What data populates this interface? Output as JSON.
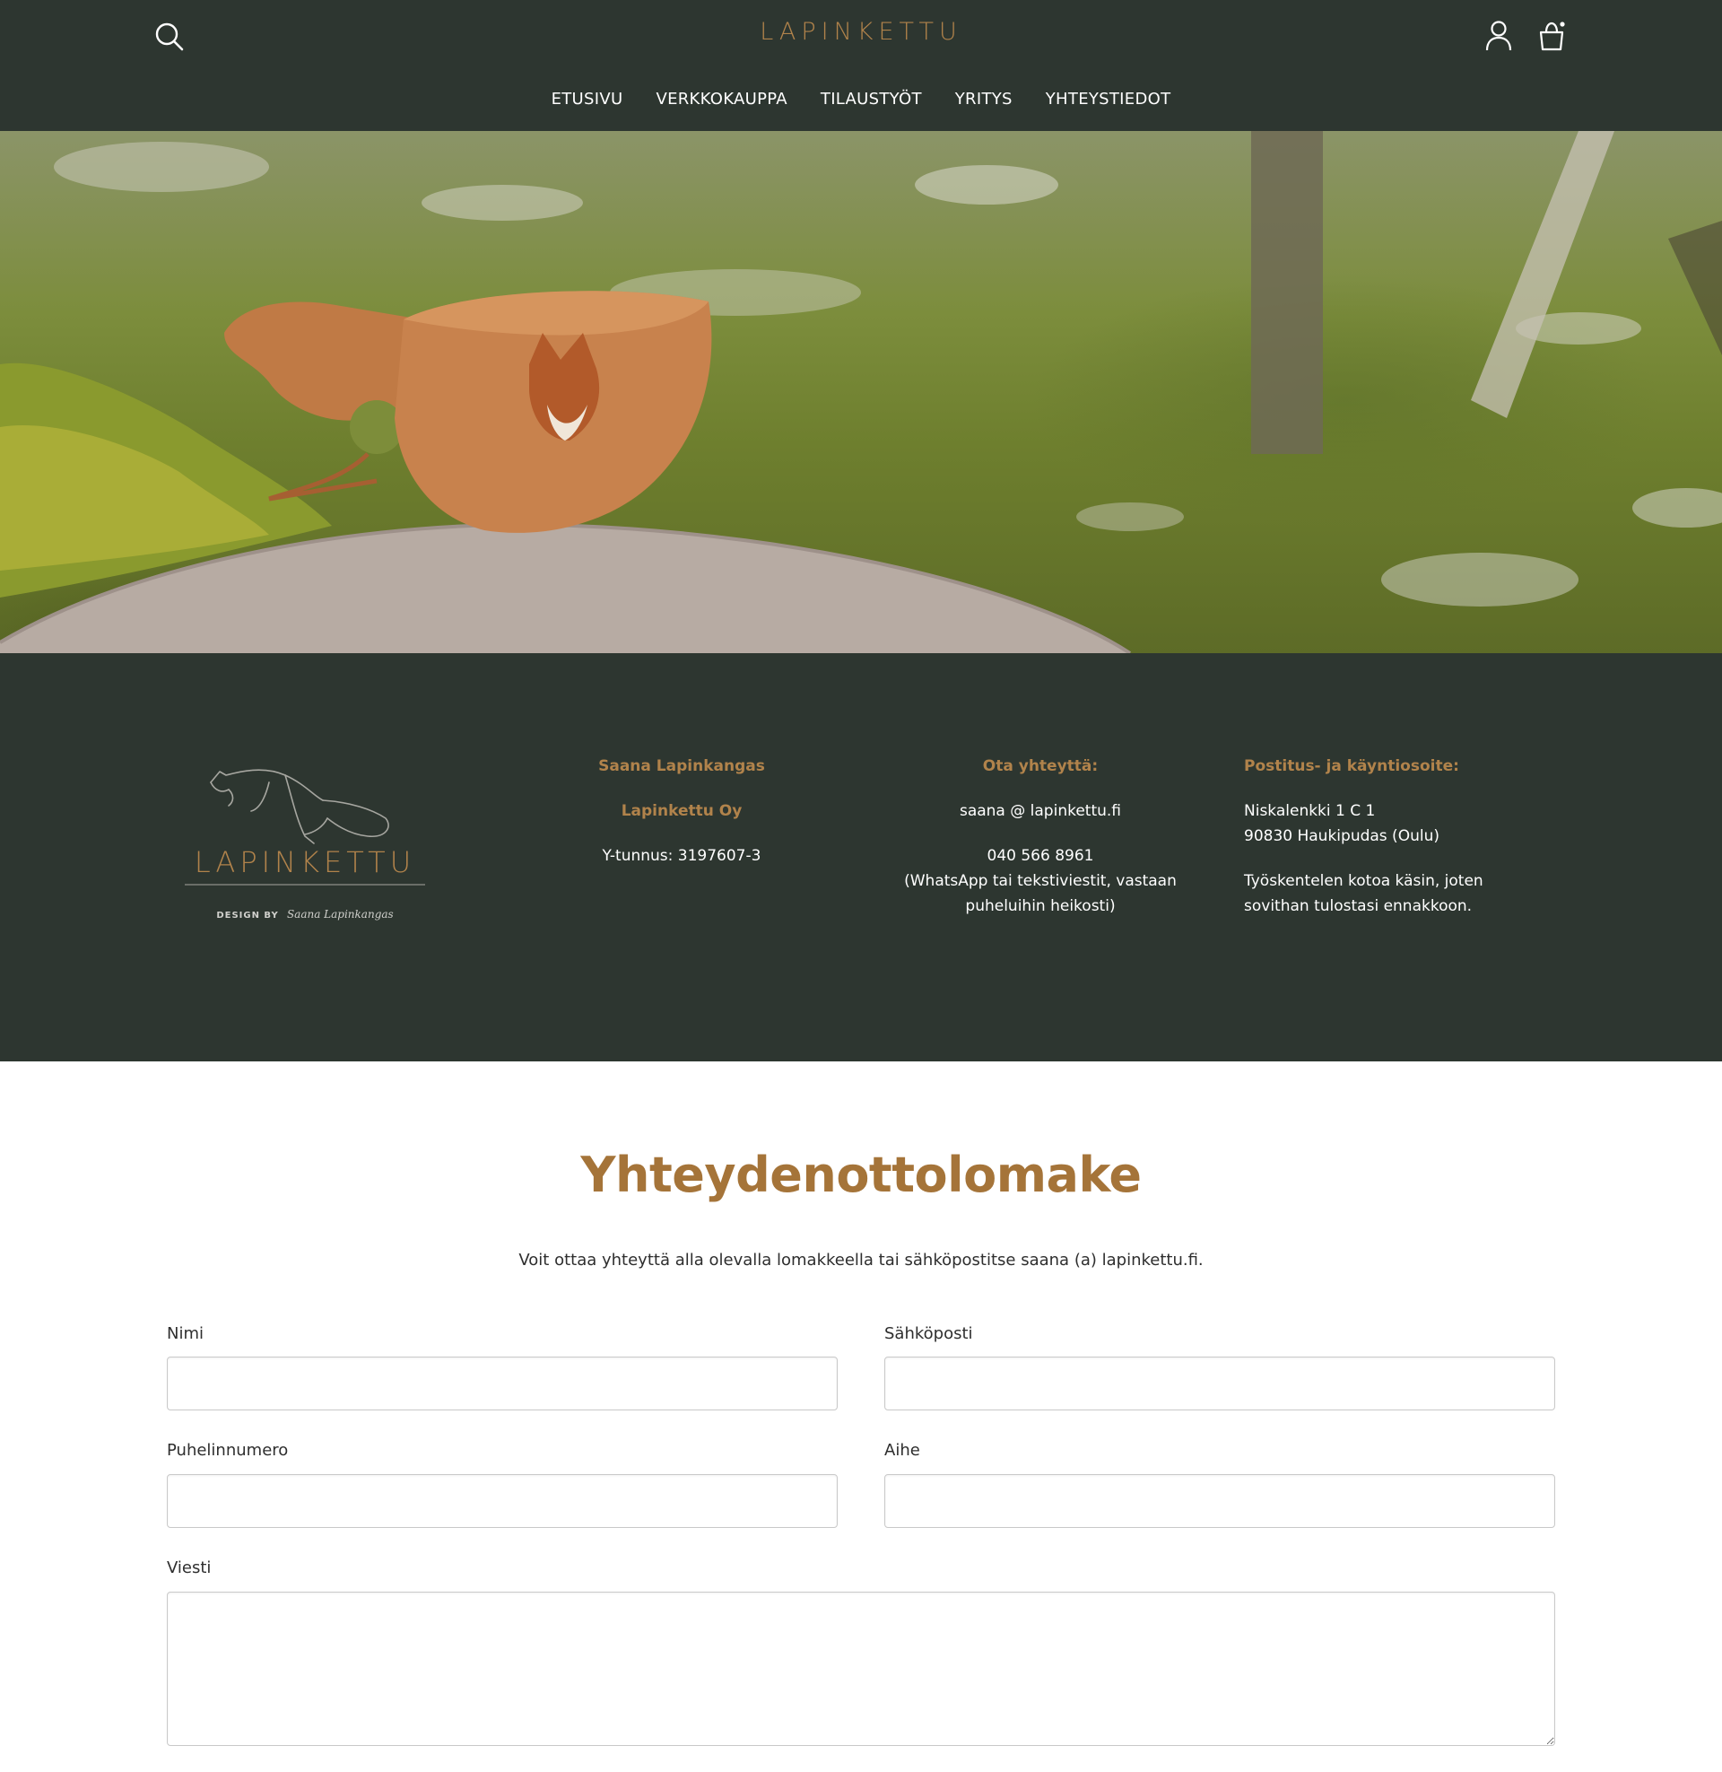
{
  "header": {
    "logo": "LAPINKETTU",
    "icons": {
      "search": "search-icon",
      "account": "user-icon",
      "cart": "shopping-bag-icon"
    },
    "nav": [
      {
        "label": "ETUSIVU"
      },
      {
        "label": "VERKKOKAUPPA"
      },
      {
        "label": "TILAUSTYÖT"
      },
      {
        "label": "YRITYS"
      },
      {
        "label": "YHTEYSTIEDOT"
      }
    ]
  },
  "hero": {
    "image": "wooden-kuksa-cup-with-fox-on-rock"
  },
  "info": {
    "brand_logo_text": "LAPINKETTU",
    "brand_tagline_prefix": "DESIGN BY",
    "brand_signature": "Saana Lapinkangas",
    "company": {
      "name": "Saana Lapinkangas",
      "company_name": "Lapinkettu Oy",
      "business_id": "Y-tunnus: 3197607-3"
    },
    "contact": {
      "heading": "Ota yhteyttä:",
      "email": "saana @ lapinkettu.fi",
      "phone": "040 566 8961",
      "phone_note_1": "(WhatsApp tai tekstiviestit, vastaan",
      "phone_note_2": "puheluihin heikosti)"
    },
    "address": {
      "heading": "Postitus- ja käyntiosoite:",
      "street": "Niskalenkki 1 C 1",
      "city": "90830 Haukipudas (Oulu)",
      "note_1": "Työskentelen kotoa käsin, joten",
      "note_2": "sovithan tulostasi ennakkoon."
    }
  },
  "form": {
    "title": "Yhteydenottolomake",
    "intro": "Voit ottaa yhteyttä alla olevalla lomakkeella tai sähköpostitse saana (a) lapinkettu.fi.",
    "fields": {
      "name": {
        "label": "Nimi",
        "value": ""
      },
      "email": {
        "label": "Sähköposti",
        "value": ""
      },
      "phone": {
        "label": "Puhelinnumero",
        "value": ""
      },
      "subject": {
        "label": "Aihe",
        "value": ""
      },
      "message": {
        "label": "Viesti",
        "value": ""
      }
    }
  },
  "colors": {
    "header_bg": "#2d3630",
    "accent": "#b1834b",
    "title": "#a57439"
  }
}
